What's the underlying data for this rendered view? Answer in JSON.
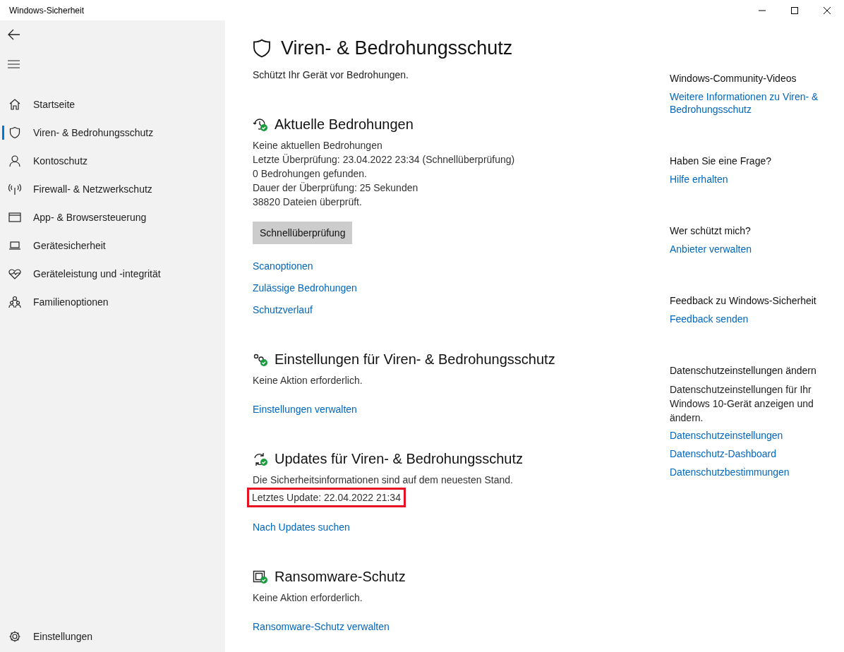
{
  "window": {
    "title": "Windows-Sicherheit"
  },
  "sidebar": {
    "items": [
      {
        "label": "Startseite",
        "selected": false
      },
      {
        "label": "Viren- & Bedrohungsschutz",
        "selected": true
      },
      {
        "label": "Kontoschutz",
        "selected": false
      },
      {
        "label": "Firewall- & Netzwerkschutz",
        "selected": false
      },
      {
        "label": "App- & Browsersteuerung",
        "selected": false
      },
      {
        "label": "Gerätesicherheit",
        "selected": false
      },
      {
        "label": "Geräteleistung und -integrität",
        "selected": false
      },
      {
        "label": "Familienoptionen",
        "selected": false
      }
    ],
    "footer": {
      "label": "Einstellungen"
    }
  },
  "page": {
    "title": "Viren- & Bedrohungsschutz",
    "subtitle": "Schützt Ihr Gerät vor Bedrohungen."
  },
  "sections": [
    {
      "title": "Aktuelle Bedrohungen",
      "lines": [
        {
          "text": "Keine aktuellen Bedrohungen",
          "highlighted": false
        },
        {
          "text": "Letzte Überprüfung: 23.04.2022 23:34 (Schnellüberprüfung)",
          "highlighted": false
        },
        {
          "text": "0 Bedrohungen gefunden.",
          "highlighted": false
        },
        {
          "text": "Dauer der Überprüfung: 25 Sekunden",
          "highlighted": false
        },
        {
          "text": "38820 Dateien überprüft.",
          "highlighted": false
        }
      ],
      "button": "Schnellüberprüfung",
      "links": [
        "Scanoptionen",
        "Zulässige Bedrohungen",
        "Schutzverlauf"
      ]
    },
    {
      "title": "Einstellungen für Viren- & Bedrohungsschutz",
      "lines": [
        {
          "text": "Keine Aktion erforderlich.",
          "highlighted": false
        }
      ],
      "links": [
        "Einstellungen verwalten"
      ]
    },
    {
      "title": "Updates für Viren- & Bedrohungsschutz",
      "lines": [
        {
          "text": "Die Sicherheitsinformationen sind auf dem neuesten Stand.",
          "highlighted": false
        },
        {
          "text": "Letztes Update: 22.04.2022 21:34",
          "highlighted": true
        }
      ],
      "links": [
        "Nach Updates suchen"
      ]
    },
    {
      "title": "Ransomware-Schutz",
      "lines": [
        {
          "text": "Keine Aktion erforderlich.",
          "highlighted": false
        }
      ],
      "links": [
        "Ransomware-Schutz verwalten"
      ]
    }
  ],
  "aside": [
    {
      "heading": "Windows-Community-Videos",
      "links": [
        "Weitere Informationen zu Viren- & Bedrohungsschutz"
      ]
    },
    {
      "heading": "Haben Sie eine Frage?",
      "links": [
        "Hilfe erhalten"
      ]
    },
    {
      "heading": "Wer schützt mich?",
      "links": [
        "Anbieter verwalten"
      ]
    },
    {
      "heading": "Feedback zu Windows-Sicherheit",
      "links": [
        "Feedback senden"
      ]
    },
    {
      "heading": "Datenschutzeinstellungen ändern",
      "text": "Datenschutzeinstellungen für Ihr Windows 10-Gerät anzeigen und ändern.",
      "links": [
        "Datenschutzeinstellungen",
        "Datenschutz-Dashboard",
        "Datenschutzbestimmungen"
      ]
    }
  ]
}
